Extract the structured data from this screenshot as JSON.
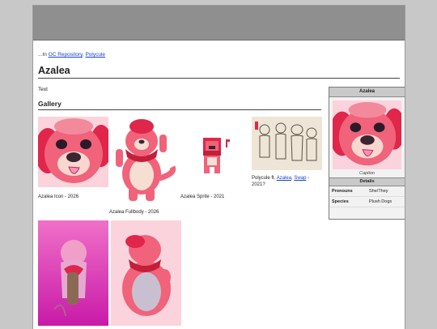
{
  "breadcrumb": {
    "prefix": "...In ",
    "links": [
      "OC Repository",
      "Polycule"
    ],
    "sep": ", "
  },
  "page_title": "Azalea",
  "intro_text": "Text",
  "gallery": {
    "heading": "Gallery",
    "items": [
      {
        "caption": "Azalea Icon - 2026"
      },
      {
        "caption": "Azalea Fullbody - 2026"
      },
      {
        "caption": "Azalea Sprite - 2021"
      },
      {
        "caption_prefix": "Polycule ft. ",
        "links": [
          "Azalea",
          "Swap"
        ],
        "caption_suffix": " - 2021?"
      }
    ]
  },
  "infobox": {
    "title": "Azalea",
    "caption": "Caption",
    "details_heading": "Details",
    "rows": [
      {
        "key": "Pronouns",
        "value": "She/They"
      },
      {
        "key": "Species",
        "value": "Plush Dogs"
      }
    ]
  },
  "colors": {
    "pink": "#f0637a",
    "deep_pink": "#d8284a",
    "bg_pink": "#fbd3dc",
    "magenta": "#e040b8"
  }
}
